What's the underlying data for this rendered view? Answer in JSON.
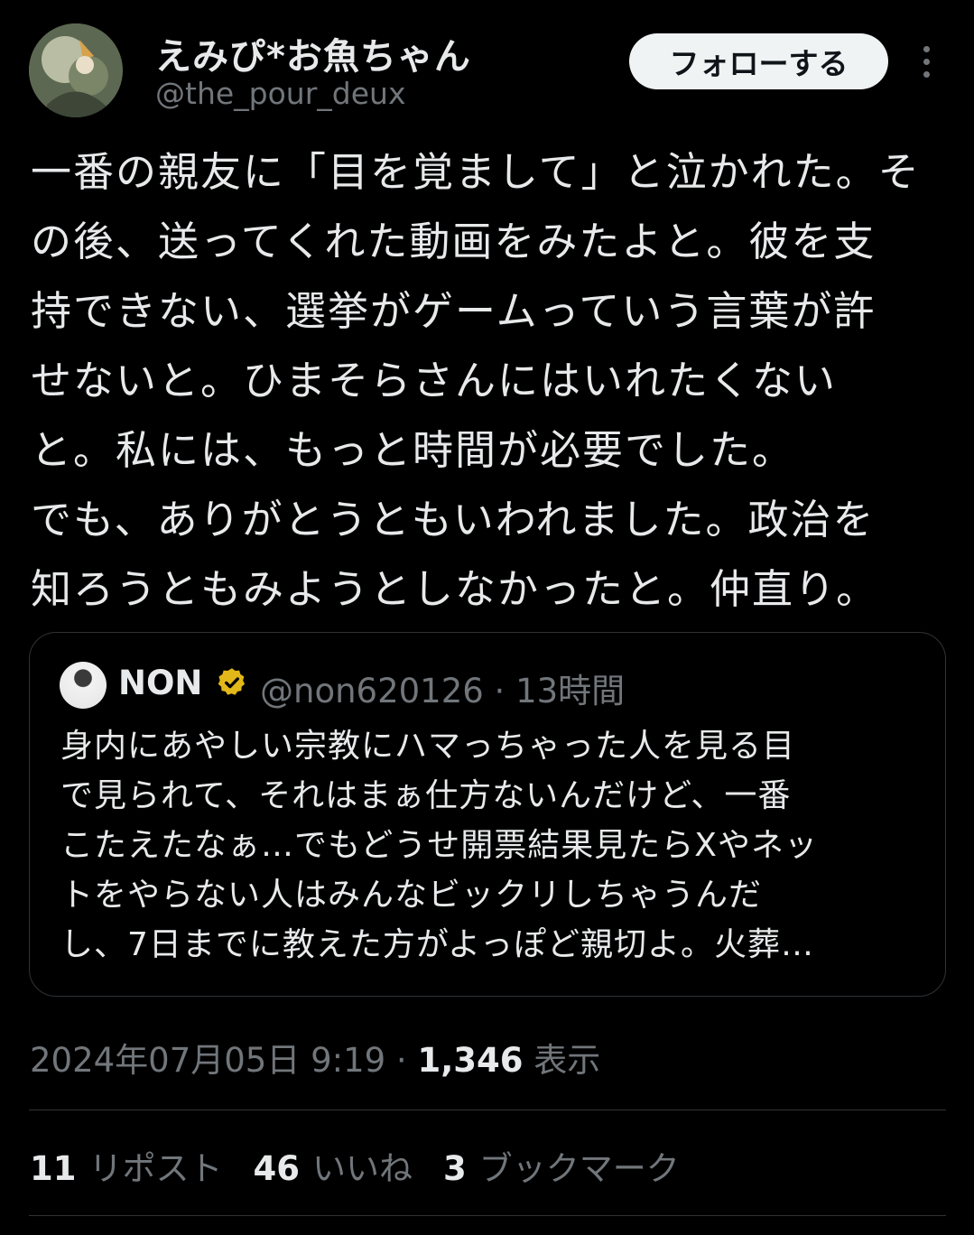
{
  "author": {
    "name": "えみぴ*お魚ちゃん",
    "handle": "@the_pour_deux"
  },
  "follow_button": "フォローする",
  "more_icon": "more-vertical-icon",
  "tweet": {
    "lines": [
      "一番の親友に「目を覚まして」と泣かれた。そ",
      "の後、送ってくれた動画をみたよと。彼を支",
      "持できない、選挙がゲームっていう言葉が許",
      "せないと。ひまそらさんにはいれたくない",
      "と。私には、もっと時間が必要でした。",
      "でも、ありがとうともいわれました。政治を",
      "知ろうともみようとしなかったと。仲直り。"
    ]
  },
  "quote": {
    "name": "NON",
    "verified_icon": "verified-badge-icon",
    "verified_color": "#e2b719",
    "handle_time": "@non620126 · 13時間",
    "lines": [
      "身内にあやしい宗教にハマっちゃった人を見る目",
      "で見られて、それはまぁ仕方ないんだけど、一番",
      "こたえたなぁ…でもどうせ開票結果見たらXやネッ",
      "トをやらない人はみんなビックリしちゃうんだ",
      "し、7日までに教えた方がよっぽど親切よ。火葬…"
    ]
  },
  "meta": {
    "datetime": "2024年07月05日 9:19 · ",
    "views": "1,346",
    "views_label": "表示"
  },
  "stats": {
    "reposts": "11",
    "reposts_label": "リポスト",
    "likes": "46",
    "likes_label": "いいね",
    "bookmarks": "3",
    "bookmarks_label": "ブックマーク"
  }
}
